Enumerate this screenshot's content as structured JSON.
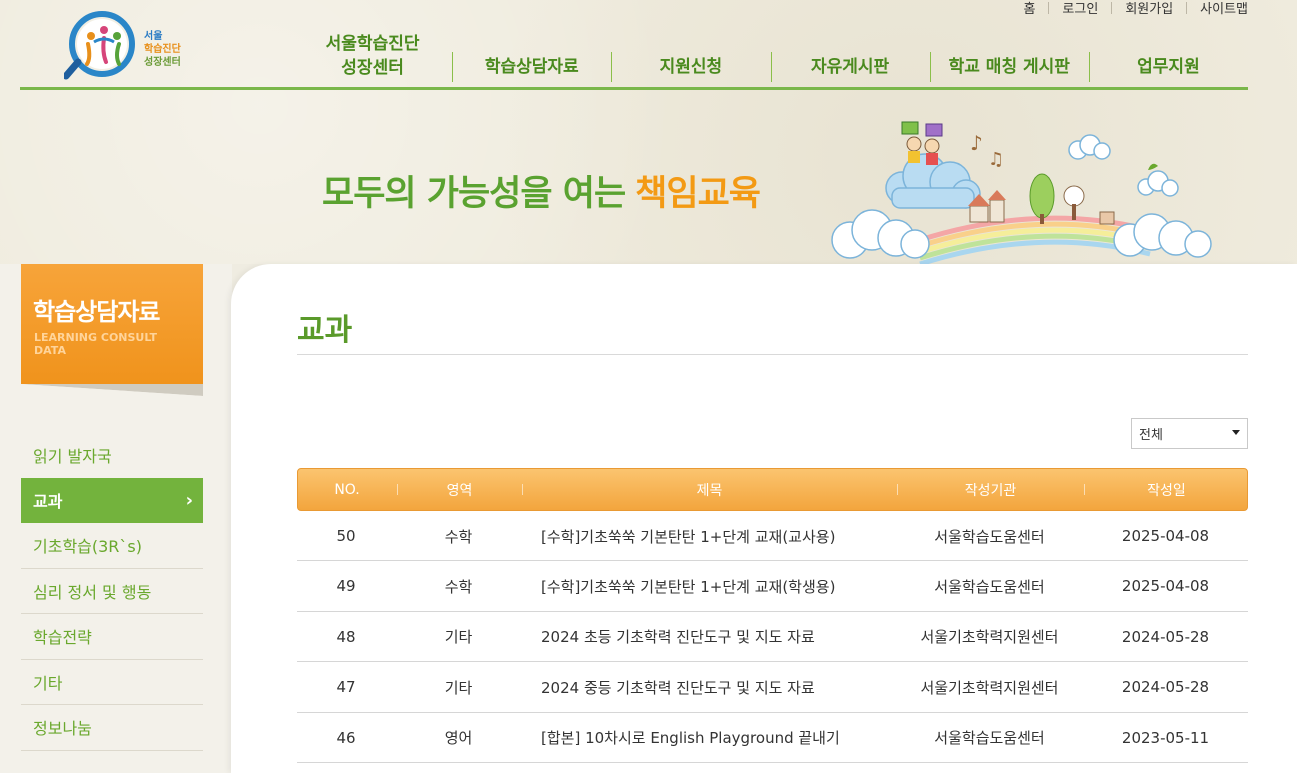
{
  "util_links": [
    "홈",
    "로그인",
    "회원가입",
    "사이트맵"
  ],
  "logo": {
    "line1": "서울",
    "line2": "학습진단",
    "line3": "성장센터"
  },
  "gnb": [
    {
      "line1": "서울학습진단",
      "line2": "성장센터"
    },
    {
      "line1": "학습상담자료",
      "line2": ""
    },
    {
      "line1": "지원신청",
      "line2": ""
    },
    {
      "line1": "자유게시판",
      "line2": ""
    },
    {
      "line1": "학교 매칭 게시판",
      "line2": ""
    },
    {
      "line1": "업무지원",
      "line2": ""
    }
  ],
  "banner": {
    "slogan_main": "모두의 가능성을 여는",
    "slogan_accent": "책임교육"
  },
  "sidebar": {
    "title": "학습상담자료",
    "subtitle_line1": "LEARNING CONSULT",
    "subtitle_line2": "DATA",
    "items": [
      {
        "label": "읽기 발자국",
        "active": false
      },
      {
        "label": "교과",
        "active": true
      },
      {
        "label": "기초학습(3R`s)",
        "active": false
      },
      {
        "label": "심리 정서 및 행동",
        "active": false
      },
      {
        "label": "학습전략",
        "active": false
      },
      {
        "label": "기타",
        "active": false
      },
      {
        "label": "정보나눔",
        "active": false
      }
    ]
  },
  "page_title": "교과",
  "filter": {
    "selected": "전체"
  },
  "table": {
    "columns": [
      "NO.",
      "영역",
      "제목",
      "작성기관",
      "작성일"
    ],
    "rows": [
      {
        "no": "50",
        "area": "수학",
        "title": "[수학]기초쑥쑥 기본탄탄 1+단계 교재(교사용)",
        "org": "서울학습도움센터",
        "date": "2025-04-08"
      },
      {
        "no": "49",
        "area": "수학",
        "title": "[수학]기초쑥쑥 기본탄탄 1+단계 교재(학생용)",
        "org": "서울학습도움센터",
        "date": "2025-04-08"
      },
      {
        "no": "48",
        "area": "기타",
        "title": "2024 초등 기초학력 진단도구 및 지도 자료",
        "org": "서울기초학력지원센터",
        "date": "2024-05-28"
      },
      {
        "no": "47",
        "area": "기타",
        "title": "2024 중등 기초학력 진단도구 및 지도 자료",
        "org": "서울기초학력지원센터",
        "date": "2024-05-28"
      },
      {
        "no": "46",
        "area": "영어",
        "title": "[합본] 10차시로 English Playground 끝내기",
        "org": "서울학습도움센터",
        "date": "2023-05-11"
      }
    ]
  }
}
